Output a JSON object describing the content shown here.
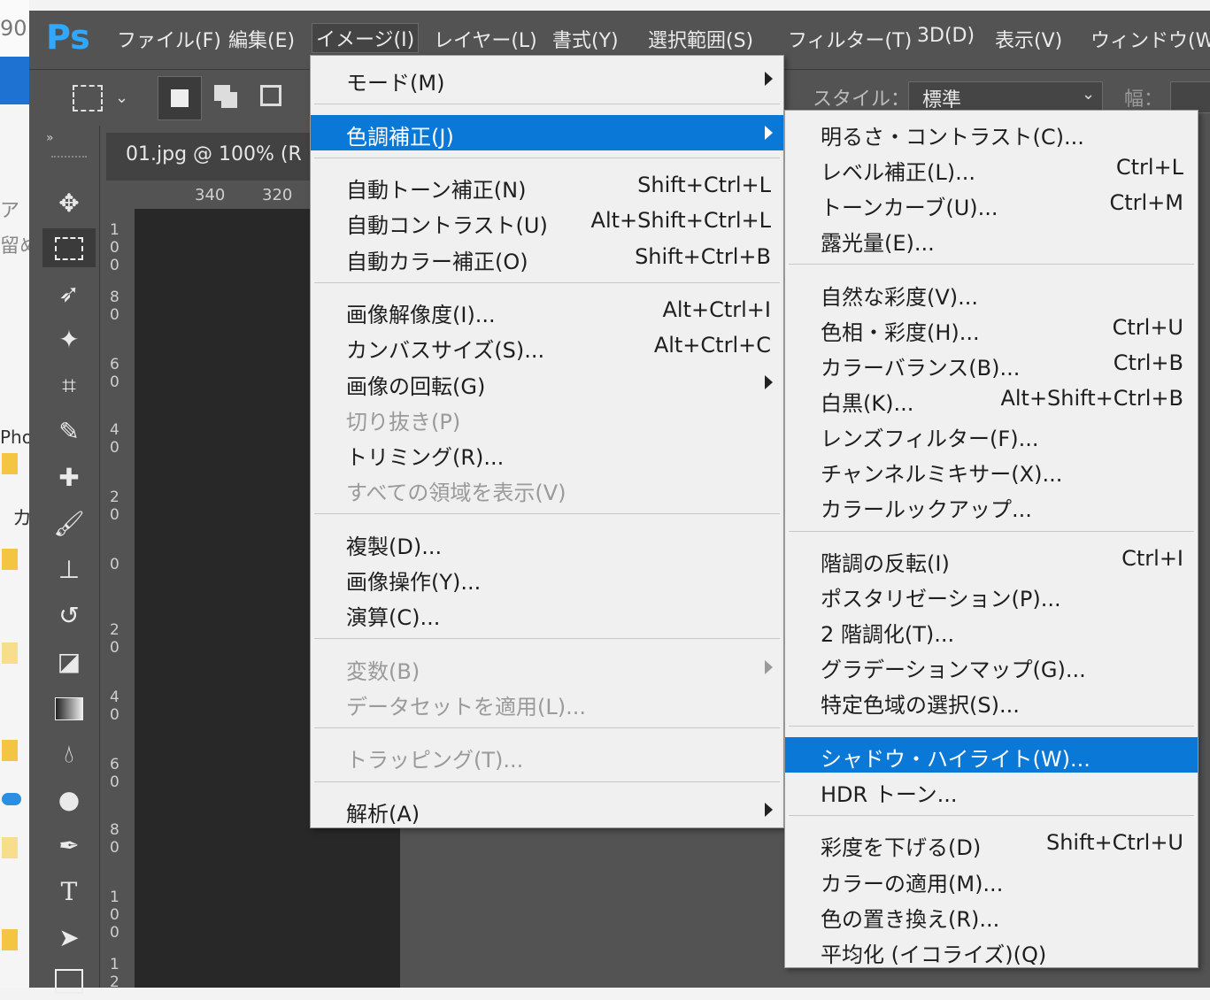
{
  "background": {
    "number": "90",
    "side_texts": [
      "ア",
      "留め",
      "Pho",
      "カ"
    ]
  },
  "app": {
    "logo": "Ps",
    "menubar": [
      {
        "label": "ファイル(F)"
      },
      {
        "label": "編集(E)"
      },
      {
        "label": "イメージ(I)",
        "active": true
      },
      {
        "label": "レイヤー(L)"
      },
      {
        "label": "書式(Y)"
      },
      {
        "label": "選択範囲(S)"
      },
      {
        "label": "フィルター(T)"
      },
      {
        "label": "3D(D)"
      },
      {
        "label": "表示(V)"
      },
      {
        "label": "ウィンドウ(W)"
      }
    ],
    "options_bar": {
      "style_label": "スタイル：",
      "style_value": "標準",
      "width_label": "幅："
    },
    "document_tab": "01.jpg @ 100% (R",
    "ruler_h": [
      "340",
      "320"
    ],
    "ruler_v": [
      "1\n0\n0",
      "8\n0",
      "6\n0",
      "4\n0",
      "2\n0",
      "0",
      "2\n0",
      "4\n0",
      "6\n0",
      "8\n0",
      "1\n0\n0",
      "1\n2"
    ],
    "tools": [
      "move-icon",
      "marquee-icon",
      "lasso-icon",
      "magic-wand-icon",
      "crop-icon",
      "eyedropper-icon",
      "healing-icon",
      "brush-icon",
      "stamp-icon",
      "history-brush-icon",
      "eraser-icon",
      "gradient-icon",
      "blur-icon",
      "dodge-icon",
      "pen-icon",
      "type-icon",
      "path-select-icon",
      "shape-icon"
    ],
    "colors": {
      "accent": "#0a78d7",
      "chrome": "#535353",
      "menu_bg": "#f0f0f0",
      "logo": "#31a8ff"
    }
  },
  "image_menu": {
    "items": [
      {
        "label": "モード(M)",
        "submenu": true
      },
      {
        "sep": true
      },
      {
        "label": "色調補正(J)",
        "submenu": true,
        "highlighted": true
      },
      {
        "sep": true
      },
      {
        "label": "自動トーン補正(N)",
        "shortcut": "Shift+Ctrl+L"
      },
      {
        "label": "自動コントラスト(U)",
        "shortcut": "Alt+Shift+Ctrl+L"
      },
      {
        "label": "自動カラー補正(O)",
        "shortcut": "Shift+Ctrl+B"
      },
      {
        "sep": true
      },
      {
        "label": "画像解像度(I)...",
        "shortcut": "Alt+Ctrl+I"
      },
      {
        "label": "カンバスサイズ(S)...",
        "shortcut": "Alt+Ctrl+C"
      },
      {
        "label": "画像の回転(G)",
        "submenu": true
      },
      {
        "label": "切り抜き(P)",
        "disabled": true
      },
      {
        "label": "トリミング(R)..."
      },
      {
        "label": "すべての領域を表示(V)",
        "disabled": true
      },
      {
        "sep": true
      },
      {
        "label": "複製(D)..."
      },
      {
        "label": "画像操作(Y)..."
      },
      {
        "label": "演算(C)..."
      },
      {
        "sep": true
      },
      {
        "label": "変数(B)",
        "submenu": true,
        "disabled": true
      },
      {
        "label": "データセットを適用(L)...",
        "disabled": true
      },
      {
        "sep": true
      },
      {
        "label": "トラッピング(T)...",
        "disabled": true
      },
      {
        "sep": true
      },
      {
        "label": "解析(A)",
        "submenu": true
      }
    ]
  },
  "adjust_menu": {
    "items": [
      {
        "label": "明るさ・コントラスト(C)..."
      },
      {
        "label": "レベル補正(L)...",
        "shortcut": "Ctrl+L"
      },
      {
        "label": "トーンカーブ(U)...",
        "shortcut": "Ctrl+M"
      },
      {
        "label": "露光量(E)..."
      },
      {
        "sep": true
      },
      {
        "label": "自然な彩度(V)..."
      },
      {
        "label": "色相・彩度(H)...",
        "shortcut": "Ctrl+U"
      },
      {
        "label": "カラーバランス(B)...",
        "shortcut": "Ctrl+B"
      },
      {
        "label": "白黒(K)...",
        "shortcut": "Alt+Shift+Ctrl+B"
      },
      {
        "label": "レンズフィルター(F)..."
      },
      {
        "label": "チャンネルミキサー(X)..."
      },
      {
        "label": "カラールックアップ..."
      },
      {
        "sep": true
      },
      {
        "label": "階調の反転(I)",
        "shortcut": "Ctrl+I"
      },
      {
        "label": "ポスタリゼーション(P)..."
      },
      {
        "label": "2 階調化(T)..."
      },
      {
        "label": "グラデーションマップ(G)..."
      },
      {
        "label": "特定色域の選択(S)..."
      },
      {
        "sep": true
      },
      {
        "label": "シャドウ・ハイライト(W)...",
        "highlighted": true
      },
      {
        "label": "HDR トーン..."
      },
      {
        "sep": true
      },
      {
        "label": "彩度を下げる(D)",
        "shortcut": "Shift+Ctrl+U"
      },
      {
        "label": "カラーの適用(M)..."
      },
      {
        "label": "色の置き換え(R)..."
      },
      {
        "label": "平均化 (イコライズ)(Q)"
      }
    ]
  }
}
